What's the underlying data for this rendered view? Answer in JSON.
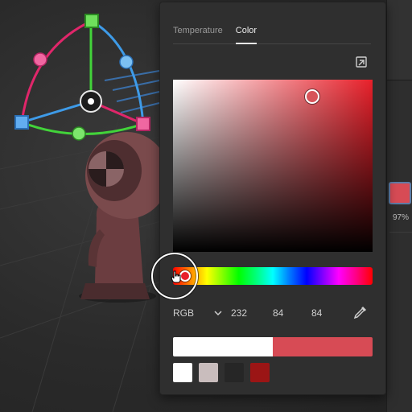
{
  "tabs": [
    {
      "label": "Temperature",
      "active": false
    },
    {
      "label": "Color",
      "active": true
    }
  ],
  "color_picker": {
    "mode": "RGB",
    "r": "232",
    "g": "84",
    "b": "84",
    "current_color": "#d74b55",
    "previous_color": "#ffffff",
    "hue_color": "#e8202a"
  },
  "swatches": [
    {
      "color": "#ffffff"
    },
    {
      "color": "#c9bdbd"
    },
    {
      "color": "#262626"
    },
    {
      "color": "#9b1515"
    }
  ],
  "side_panel": {
    "swatch_color": "#d74b55",
    "opacity_label": "97%"
  },
  "icons": {
    "pop_out": "pop-out-icon",
    "chevron": "chevron-down-icon",
    "eyedropper": "eyedropper-icon",
    "cursor": "hand-cursor-icon"
  }
}
